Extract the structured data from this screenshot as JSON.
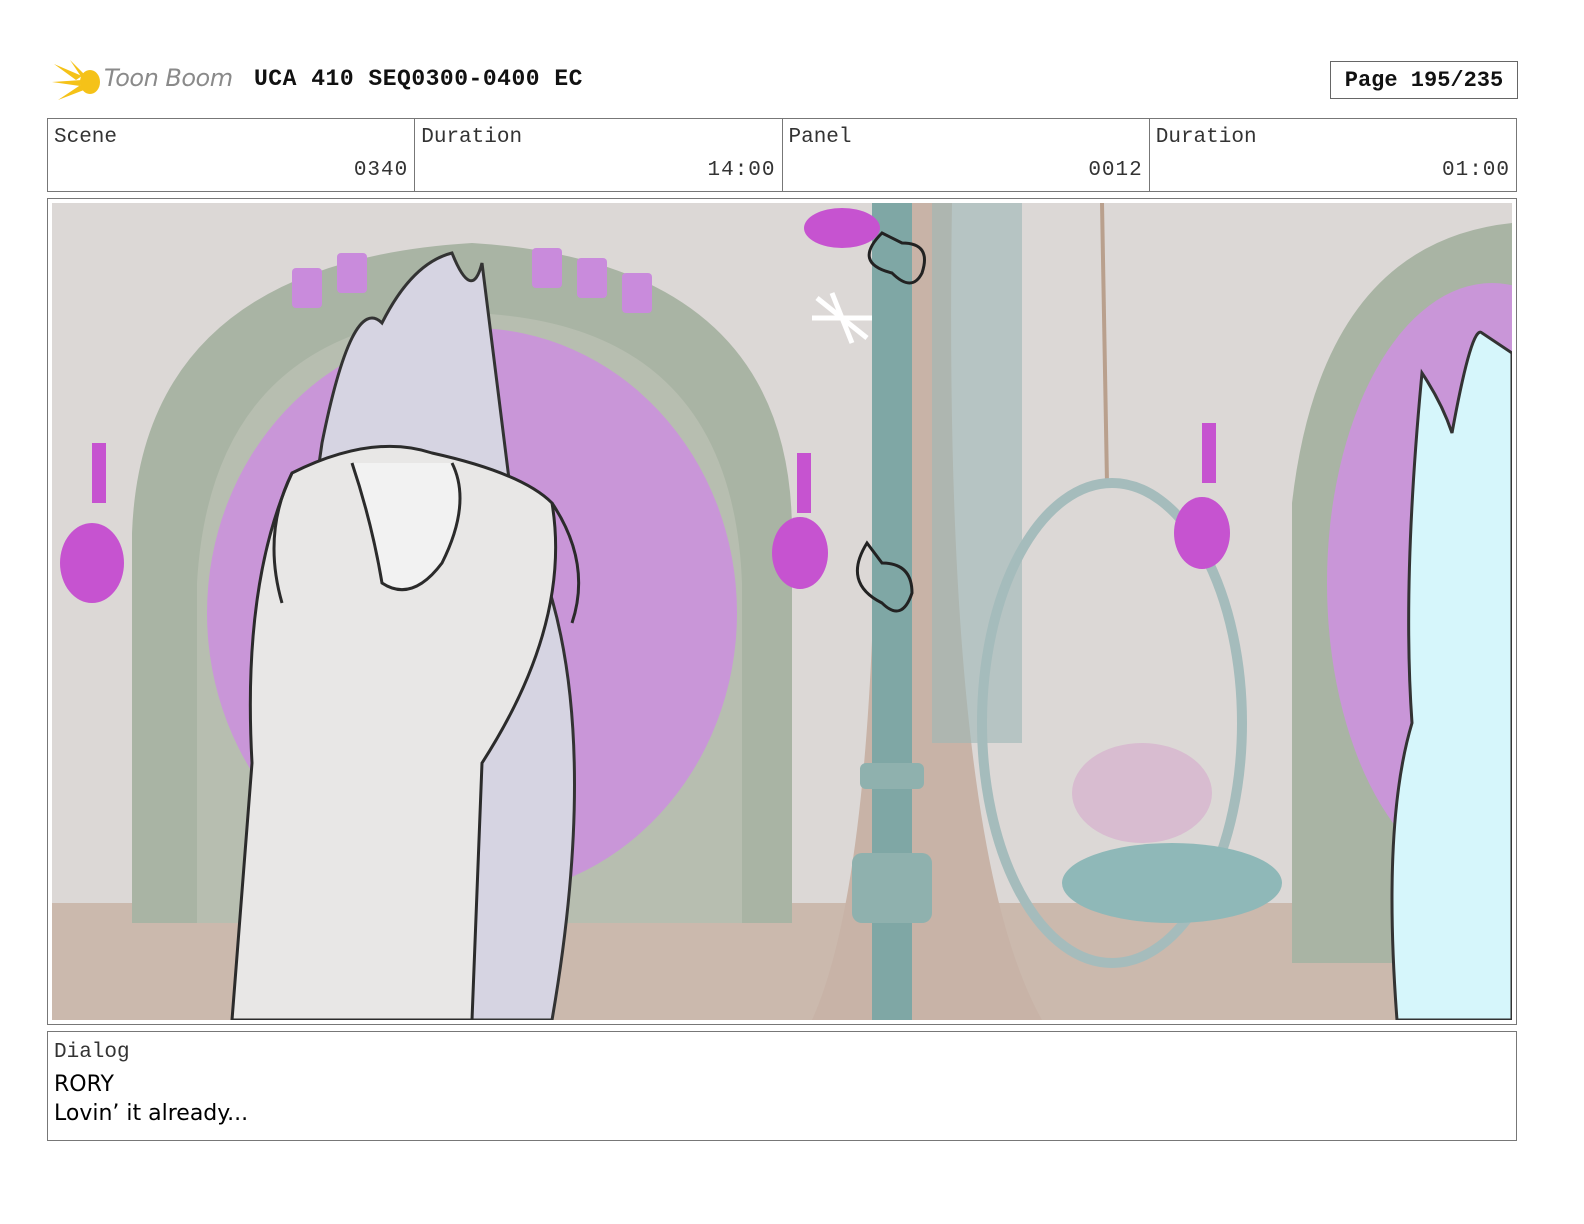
{
  "header": {
    "logo_text": "Toon Boom",
    "title": "UCA 410 SEQ0300-0400 EC",
    "page": "Page 195/235"
  },
  "info": {
    "scene_label": "Scene",
    "scene_value": "0340",
    "scene_duration_label": "Duration",
    "scene_duration_value": "14:00",
    "panel_label": "Panel",
    "panel_value": "0012",
    "panel_duration_label": "Duration",
    "panel_duration_value": "01:00"
  },
  "panel": {
    "icon": "storyboard-sketch-image"
  },
  "dialog": {
    "label": "Dialog",
    "speaker": "RORY",
    "line": "Lovin’ it already..."
  },
  "colors": {
    "logo_yellow": "#f5c218",
    "border": "#777777",
    "portal_purple": "#c996d8",
    "arch_green": "#a9b4a4",
    "unicorn_cyan": "#d6f6fb"
  }
}
